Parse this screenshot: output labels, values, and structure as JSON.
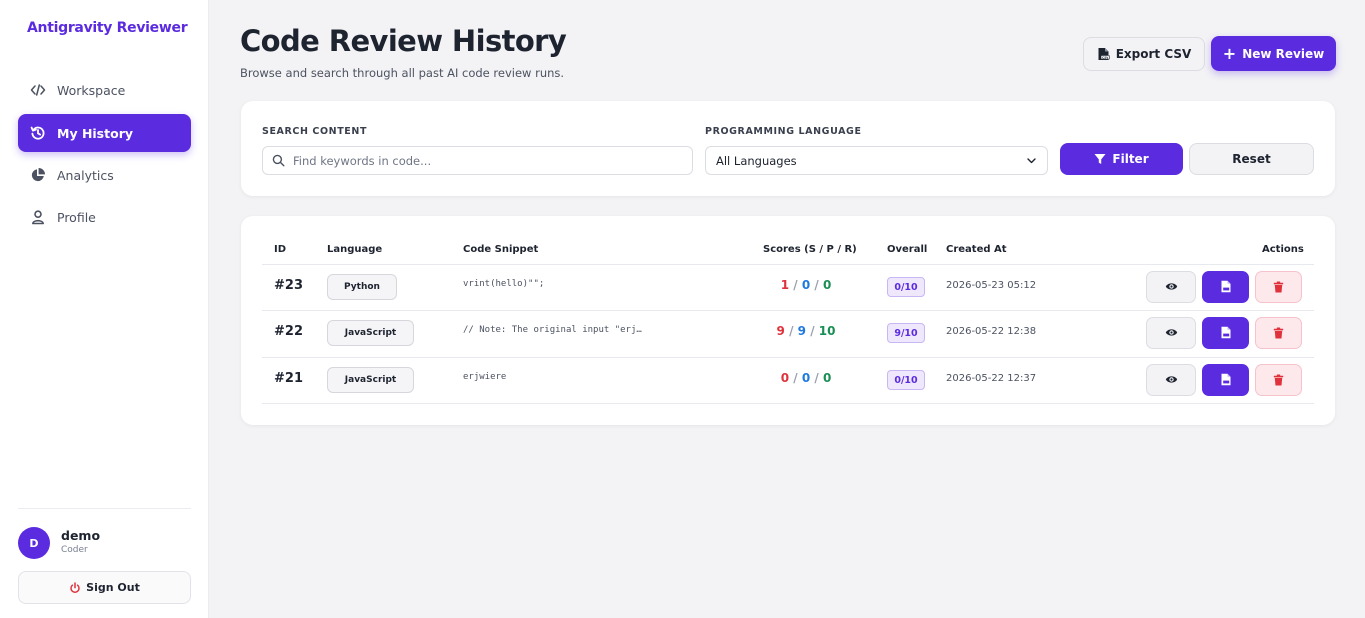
{
  "brand": "Antigravity Reviewer",
  "sidebar": {
    "items": [
      {
        "label": "Workspace",
        "icon": "code-icon",
        "active": false
      },
      {
        "label": "My History",
        "icon": "history-icon",
        "active": true
      },
      {
        "label": "Analytics",
        "icon": "pie-chart-icon",
        "active": false
      },
      {
        "label": "Profile",
        "icon": "user-icon",
        "active": false
      }
    ],
    "user": {
      "initial": "D",
      "name": "demo",
      "role": "Coder"
    },
    "sign_out": "Sign Out"
  },
  "header": {
    "title": "Code Review History",
    "subtitle": "Browse and search through all past AI code review runs.",
    "export_label": "Export CSV",
    "new_label": "New Review"
  },
  "filters": {
    "search_label": "SEARCH CONTENT",
    "search_placeholder": "Find keywords in code...",
    "search_value": "",
    "language_label": "PROGRAMMING LANGUAGE",
    "language_selected": "All Languages",
    "filter_button": "Filter",
    "reset_button": "Reset"
  },
  "table": {
    "columns": {
      "id": "ID",
      "language": "Language",
      "snippet": "Code Snippet",
      "scores": "Scores (S / P / R)",
      "overall": "Overall",
      "created": "Created At",
      "actions": "Actions"
    },
    "rows": [
      {
        "id": "#23",
        "language": "Python",
        "snippet": "vrint(hello)\"\";",
        "s": "1",
        "p": "0",
        "r": "0",
        "overall": "0/10",
        "created": "2026-05-23 05:12"
      },
      {
        "id": "#22",
        "language": "JavaScript",
        "snippet": "// Note: The original input \"erj…",
        "s": "9",
        "p": "9",
        "r": "10",
        "overall": "9/10",
        "created": "2026-05-22 12:38"
      },
      {
        "id": "#21",
        "language": "JavaScript",
        "snippet": "erjwiere",
        "s": "0",
        "p": "0",
        "r": "0",
        "overall": "0/10",
        "created": "2026-05-22 12:37"
      }
    ],
    "score_separator": "/"
  },
  "colors": {
    "accent": "#5b2be0",
    "security": "#e0323c",
    "performance": "#1f7ae0",
    "readability": "#1a8f55",
    "delete": "#e0323c"
  }
}
